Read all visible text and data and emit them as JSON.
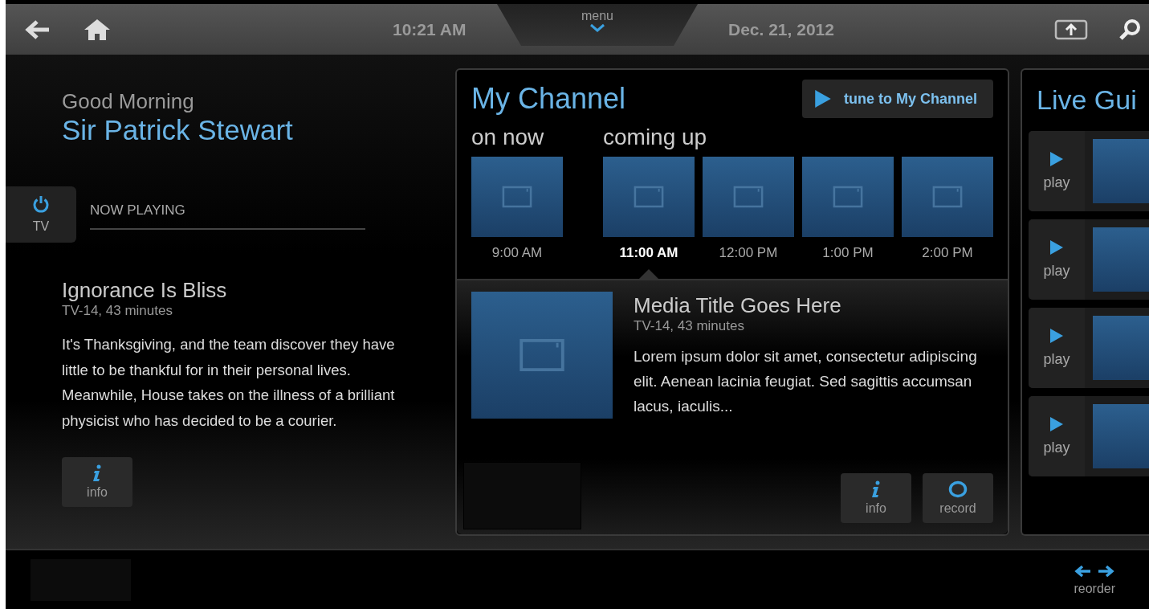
{
  "top_bar": {
    "time": "10:21 AM",
    "menu": "menu",
    "date": "Dec. 21, 2012"
  },
  "greeting": "Good Morning",
  "user_name": "Sir Patrick Stewart",
  "tv_tab": {
    "label": "TV"
  },
  "now_playing": {
    "heading": "NOW PLAYING",
    "title": "Ignorance Is Bliss",
    "meta": "TV-14, 43 minutes",
    "description": "It's Thanksgiving, and the team discover they have little to be thankful for in their personal lives. Meanwhile, House takes on the illness of a brilliant physicist who has decided to be a courier.",
    "info_button": "info"
  },
  "my_channel": {
    "title": "My Channel",
    "tune_button": "tune to My Channel",
    "groups": [
      {
        "label": "on now",
        "slots": [
          {
            "time": "9:00 AM",
            "selected": false
          }
        ]
      },
      {
        "label": "coming up",
        "slots": [
          {
            "time": "11:00 AM",
            "selected": true
          },
          {
            "time": "12:00 PM",
            "selected": false
          },
          {
            "time": "1:00 PM",
            "selected": false
          },
          {
            "time": "2:00 PM",
            "selected": false
          }
        ]
      }
    ],
    "detail": {
      "title": "Media Title Goes Here",
      "meta": "TV-14, 43 minutes",
      "description": "Lorem ipsum dolor sit amet, consectetur adipiscing elit. Aenean lacinia feugiat. Sed sagittis accumsan lacus, iaculis...",
      "buttons": [
        {
          "kind": "info",
          "label": "info"
        },
        {
          "kind": "record",
          "label": "record"
        }
      ]
    }
  },
  "live_guide": {
    "title": "Live Gui",
    "rows": [
      {
        "label": "play"
      },
      {
        "label": "play"
      },
      {
        "label": "play"
      },
      {
        "label": "play"
      }
    ]
  },
  "bottom_bar": {
    "reorder": "reorder"
  }
}
